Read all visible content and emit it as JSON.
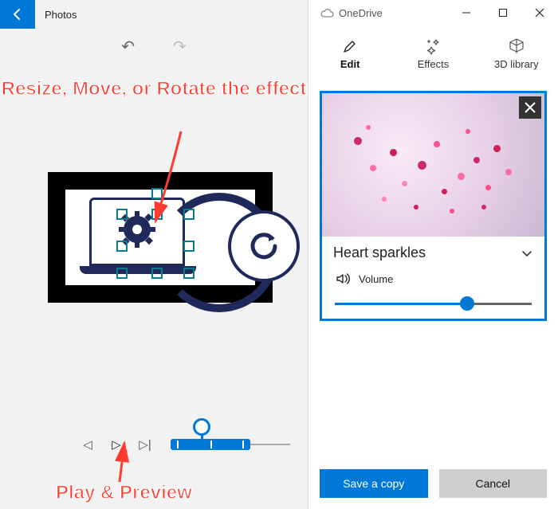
{
  "left": {
    "app_title": "Photos",
    "annotation_resize": "Resize, Move, or Rotate the effect",
    "annotation_play": "Play & Preview"
  },
  "right": {
    "cloud_label": "OneDrive",
    "tabs": {
      "edit": "Edit",
      "effects": "Effects",
      "library": "3D library"
    },
    "effect_name": "Heart sparkles",
    "volume_label": "Volume",
    "save_label": "Save a copy",
    "cancel_label": "Cancel"
  },
  "colors": {
    "accent": "#0078d7",
    "annotation": "#ff3a2f"
  }
}
